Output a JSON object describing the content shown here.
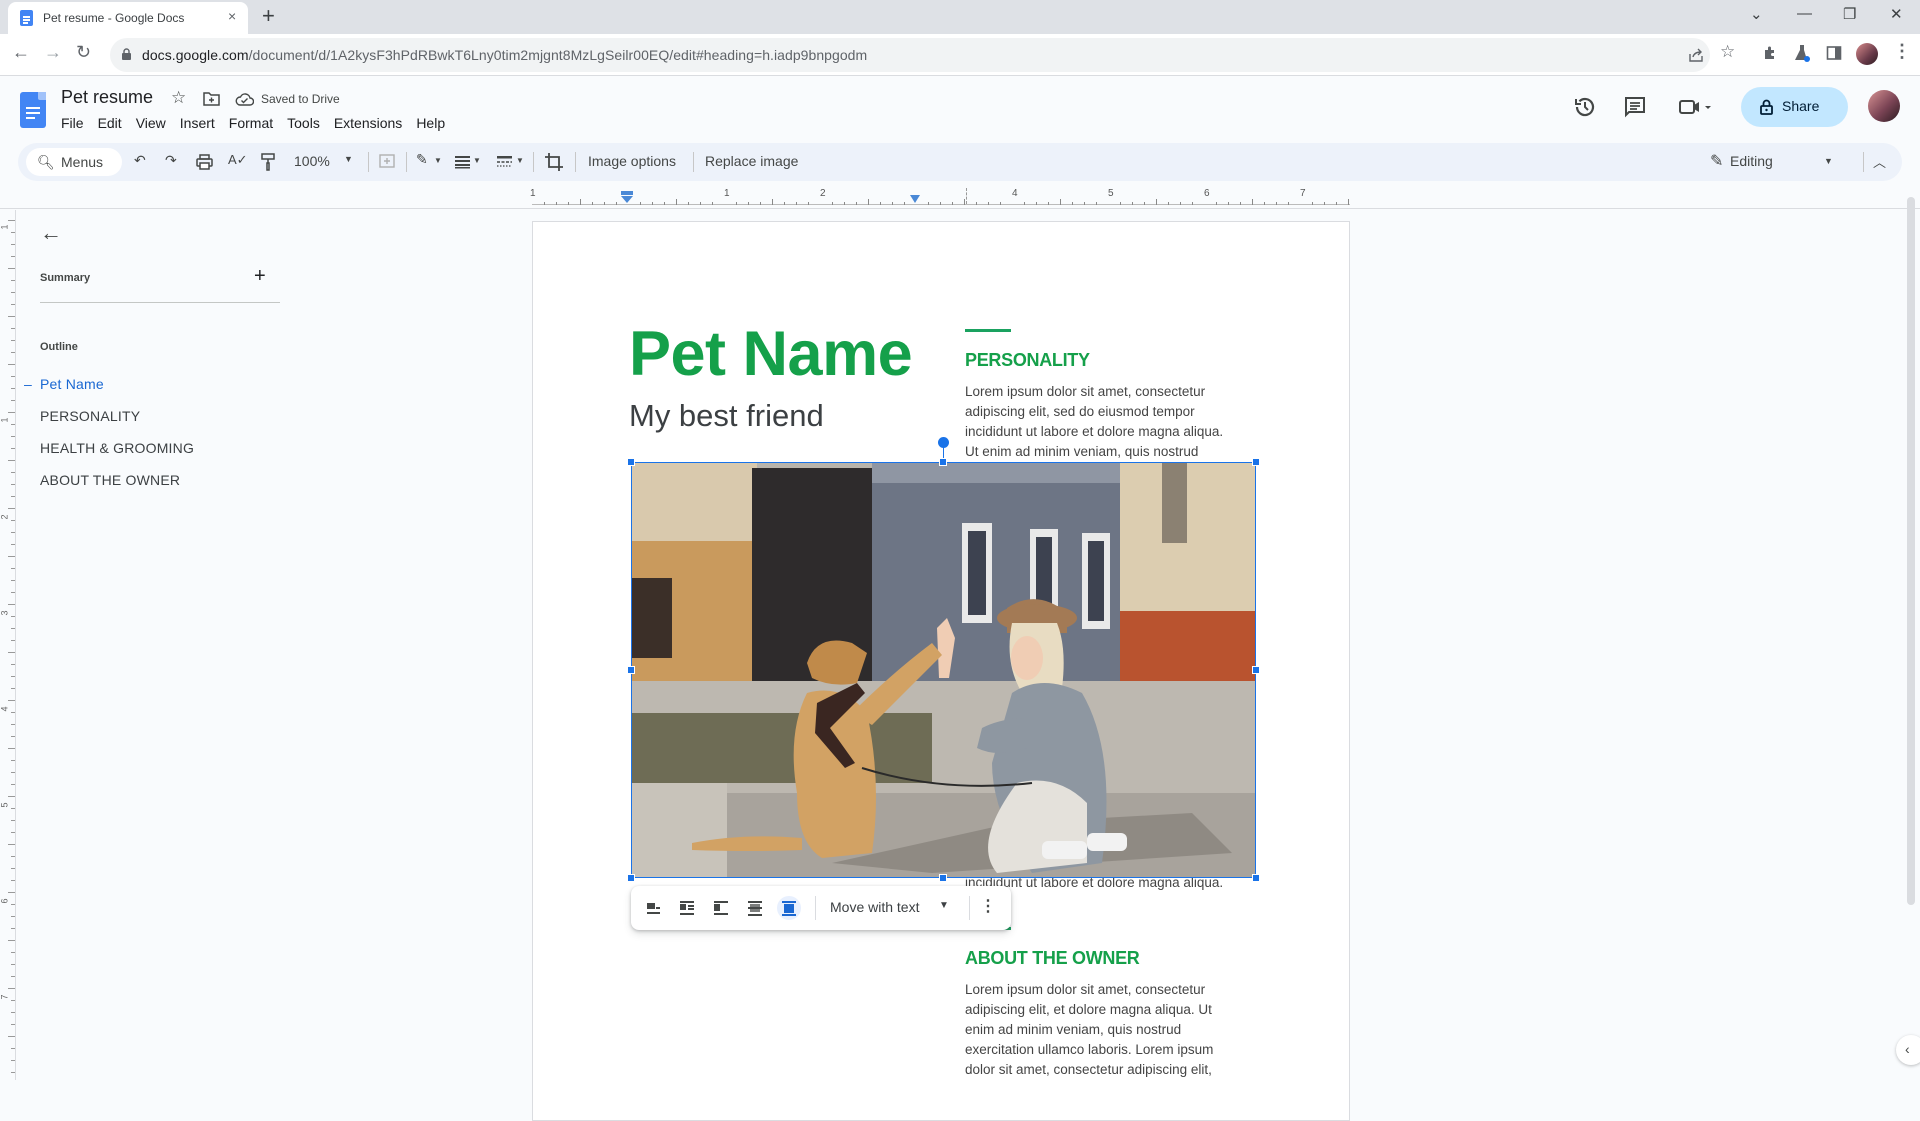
{
  "browser": {
    "tab_title": "Pet resume - Google Docs",
    "tab_close": "×",
    "new_tab": "+",
    "url_host": "docs.google.com",
    "url_path": "/document/d/1A2kysF3hPdRBwkT6Lny0tim2mjgnt8MzLgSeilr00EQ/edit#heading=h.iadp9bnpgodm",
    "window_controls": {
      "tab_search": "⌄",
      "minimize": "—",
      "restore": "❐",
      "close": "✕"
    }
  },
  "docs_header": {
    "title": "Pet resume",
    "save_status": "Saved to Drive",
    "menu": [
      "File",
      "Edit",
      "View",
      "Insert",
      "Format",
      "Tools",
      "Extensions",
      "Help"
    ],
    "share_label": "Share"
  },
  "toolbar": {
    "search_label": "Menus",
    "zoom": "100%",
    "image_options": "Image options",
    "replace_image": "Replace image",
    "mode": "Editing"
  },
  "ruler": {
    "labels": [
      "1",
      "1",
      "2",
      "3",
      "4",
      "5",
      "6",
      "7"
    ]
  },
  "vertical_ruler": {
    "labels": [
      "1",
      "1",
      "2",
      "3",
      "4",
      "5",
      "6",
      "7"
    ]
  },
  "sidebar": {
    "summary_label": "Summary",
    "outline_label": "Outline",
    "outline_items": [
      {
        "label": "Pet Name",
        "active": true
      },
      {
        "label": "PERSONALITY",
        "active": false
      },
      {
        "label": "HEALTH & GROOMING",
        "active": false
      },
      {
        "label": "ABOUT THE OWNER",
        "active": false
      }
    ]
  },
  "document": {
    "title": "Pet Name",
    "subtitle": "My best friend",
    "personality": {
      "heading": "PERSONALITY",
      "lines": [
        "Lorem ipsum dolor sit amet, consectetur",
        "adipiscing elit, sed do eiusmod tempor",
        "incididunt ut labore et dolore magna aliqua.",
        "Ut enim ad minim veniam, quis nostrud"
      ],
      "line_after_image": "incididunt ut labore et dolore magna aliqua."
    },
    "about_owner": {
      "heading": "ABOUT THE OWNER",
      "lines": [
        "Lorem ipsum dolor sit amet, consectetur",
        "adipiscing elit, et dolore magna aliqua. Ut",
        "enim ad minim veniam, quis nostrud",
        "exercitation ullamco laboris. Lorem ipsum",
        "dolor sit amet, consectetur adipiscing elit,"
      ]
    },
    "image": {
      "description": "Woman in hat high-fiving a golden dog on a street"
    }
  },
  "image_toolbar": {
    "wrap_modes": [
      "In line",
      "Wrap text",
      "Break text",
      "Behind text",
      "In front of text"
    ],
    "active_wrap": 4,
    "position": "Move with text"
  },
  "colors": {
    "accent_green": "#15a04a",
    "selection_blue": "#1a73e8",
    "share_bg": "#c2e7ff",
    "toolbar_bg": "#edf2fa"
  }
}
